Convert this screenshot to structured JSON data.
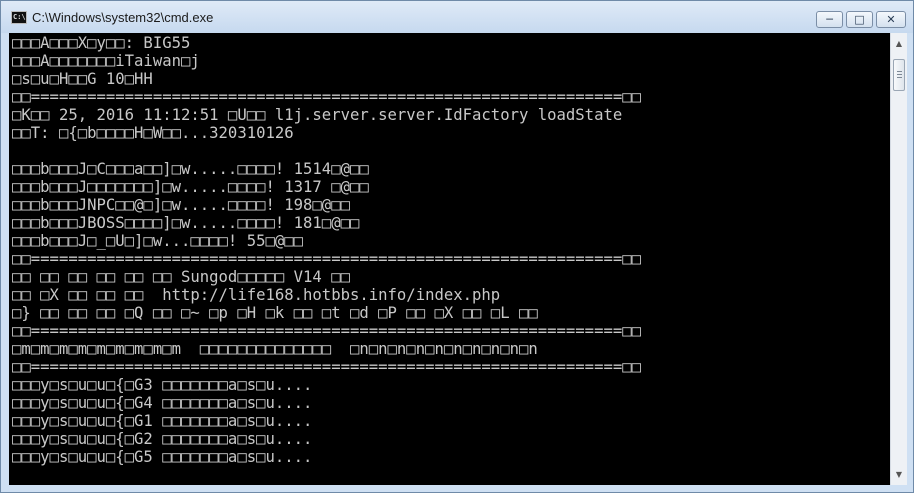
{
  "window": {
    "title": "C:\\Windows\\system32\\cmd.exe",
    "icon_label": "C:\\",
    "controls": {
      "minimize": "─",
      "maximize": "□",
      "close": "✕"
    }
  },
  "console": {
    "lines": [
      "□□□A□□□X□y□□: BIG55",
      "□□□A□□□□□□□iTaiwan□j",
      "□s□u□H□□G 10□HH",
      "□□===============================================================□□",
      "□K□□ 25, 2016 11:12:51 □U□□ l1j.server.server.IdFactory loadState",
      "□□T: □{□b□□□□H□W□□...320310126",
      "",
      "□□□b□□□J□C□□□a□□]□w.....□□□□! 1514□@□□",
      "□□□b□□□J□□□□□□□]□w.....□□□□! 1317 □@□□",
      "□□□b□□□JNPC□□@□]□w.....□□□□! 198□@□□",
      "□□□b□□□JBOSS□□□□]□w.....□□□□! 181□@□□",
      "□□□b□□□J□_□U□]□w...□□□□! 55□@□□",
      "□□===============================================================□□",
      "□□ □□ □□ □□ □□ □□ Sungod□□□□□ V14 □□",
      "□□ □X □□ □□ □□  http://life168.hotbbs.info/index.php",
      "□} □□ □□ □□ □Q □□ □~ □p □H □k □□ □t □d □P □□ □X □□ □L □□",
      "□□===============================================================□□",
      "□m□m□m□m□m□m□m□m□m  □□□□□□□□□□□□□□  □n□n□n□n□n□n□n□n□n□n",
      "□□===============================================================□□",
      "□□□y□s□u□u□{□G3 □□□□□□□a□s□u....",
      "□□□y□s□u□u□{□G4 □□□□□□□a□s□u....",
      "□□□y□s□u□u□{□G1 □□□□□□□a□s□u....",
      "□□□y□s□u□u□{□G2 □□□□□□□a□s□u....",
      "□□□y□s□u□u□{□G5 □□□□□□□a□s□u...."
    ]
  },
  "scrollbar": {
    "up_arrow": "▲",
    "down_arrow": "▼"
  },
  "colors": {
    "console_bg": "#000000",
    "console_text": "#c8c8c8",
    "frame": "#cfe0f3"
  }
}
